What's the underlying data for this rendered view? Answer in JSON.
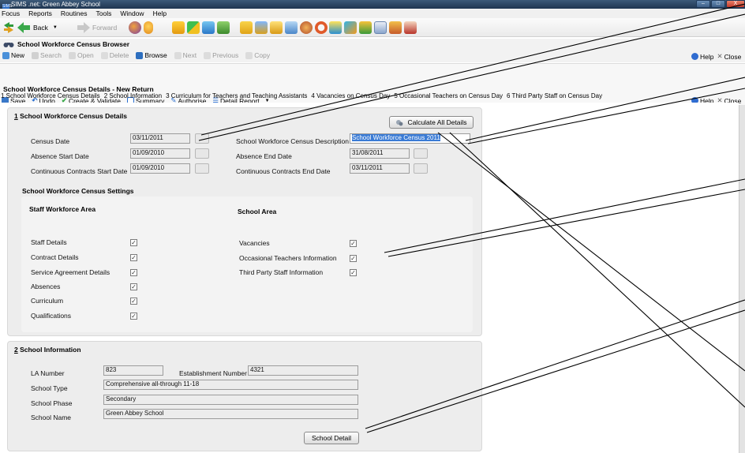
{
  "window": {
    "title": "SIMS .net: Green Abbey School",
    "app_icon": "SIMS"
  },
  "menu": [
    "Focus",
    "Reports",
    "Routines",
    "Tools",
    "Window",
    "Help"
  ],
  "main_toolbar": {
    "back": "Back",
    "forward": "Forward"
  },
  "browser": {
    "title": "School Workforce Census Browser",
    "buttons": {
      "new": "New",
      "search": "Search",
      "open": "Open",
      "delete": "Delete",
      "browse": "Browse",
      "next": "Next",
      "previous": "Previous",
      "copy": "Copy"
    },
    "help": "Help",
    "close": "Close"
  },
  "details": {
    "title": "School Workforce Census Details - New Return",
    "buttons": {
      "save": "Save",
      "undo": "Undo",
      "create_validate": "Create & Validate",
      "summary": "Summary",
      "authorise": "Authorise",
      "detail_report": "Detail Report"
    },
    "help": "Help",
    "close": "Close"
  },
  "tabs": [
    "1 School Workforce Census Details",
    "2 School Information",
    "3 Curriculum for Teachers and Teaching Assistants",
    "4 Vacancies on Census Day",
    "5 Occasional Teachers on Census Day",
    "6 Third Party Staff on Census Day"
  ],
  "section1": {
    "heading_num": "1",
    "heading": " School Workforce Census Details",
    "calculate_button": "Calculate All Details",
    "census_date_label": "Census Date",
    "census_date": "03/11/2011",
    "description_label": "School Workforce Census Description",
    "description": "School Workforce Census 2011",
    "absence_start_label": "Absence Start Date",
    "absence_start": "01/09/2010",
    "absence_end_label": "Absence End Date",
    "absence_end": "31/08/2011",
    "contracts_start_label": "Continuous Contracts Start Date",
    "contracts_start": "01/09/2010",
    "contracts_end_label": "Continuous Contracts End Date",
    "contracts_end": "03/11/2011"
  },
  "settings": {
    "title": "School Workforce Census Settings",
    "staff_area_title": "Staff Workforce Area",
    "staff_items": [
      "Staff Details",
      "Contract Details",
      "Service Agreement Details",
      "Absences",
      "Curriculum",
      "Qualifications"
    ],
    "school_area_title": "School Area",
    "school_items": [
      "Vacancies",
      "Occasional Teachers Information",
      "Third Party Staff Information"
    ],
    "check_mark": "✓"
  },
  "section2": {
    "heading_num": "2",
    "heading": " School Information",
    "la_number_label": "LA Number",
    "la_number": "823",
    "establishment_label": "Establishment Number",
    "establishment": "4321",
    "school_type_label": "School Type",
    "school_type": "Comprehensive all-through 11-18",
    "school_phase_label": "School Phase",
    "school_phase": "Secondary",
    "school_name_label": "School Name",
    "school_name": "Green Abbey School",
    "school_detail_button": "School Detail"
  },
  "window_buttons": {
    "minimize": "–",
    "maximize": "□",
    "close": "X"
  },
  "colors": {
    "title_bar": "#2a4566",
    "selection": "#3a7bd5",
    "panel": "#ededed"
  }
}
